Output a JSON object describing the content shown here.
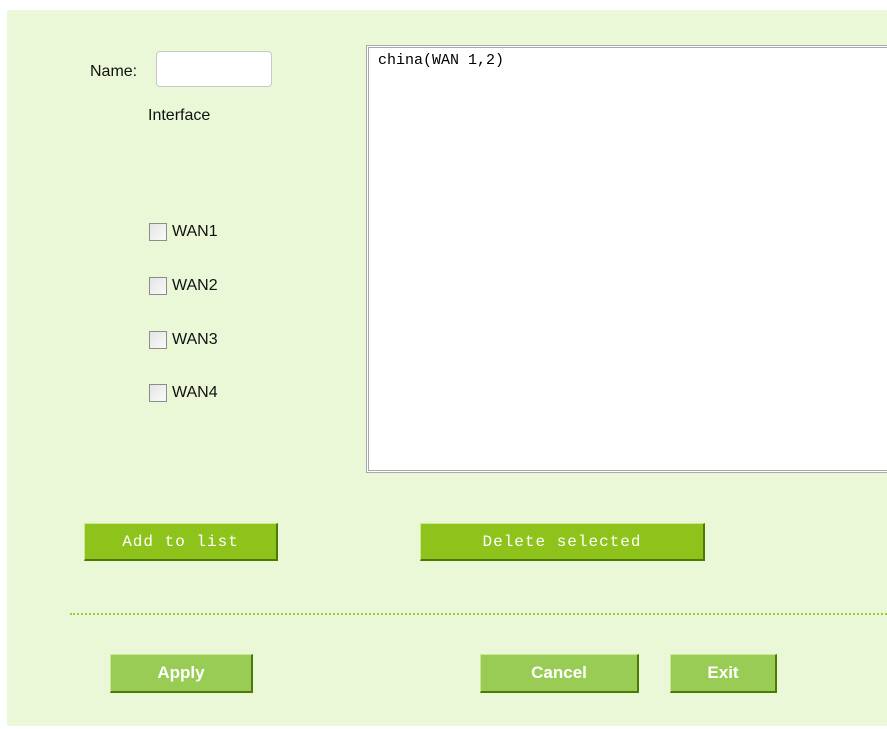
{
  "form": {
    "name_label": "Name:",
    "name_value": "",
    "interface_label": "Interface"
  },
  "interfaces": [
    {
      "label": "WAN1",
      "checked": false
    },
    {
      "label": "WAN2",
      "checked": false
    },
    {
      "label": "WAN3",
      "checked": false
    },
    {
      "label": "WAN4",
      "checked": false
    }
  ],
  "list": {
    "items": [
      "china(WAN 1,2)"
    ]
  },
  "buttons": {
    "add_to_list": "Add to list",
    "delete_selected": "Delete selected",
    "apply": "Apply",
    "cancel": "Cancel",
    "exit": "Exit"
  },
  "colors": {
    "panel_background": "#ebf8d7",
    "button_bright": "#8dc31a",
    "button_soft": "#99cc55",
    "separator": "#9ccc3c"
  }
}
